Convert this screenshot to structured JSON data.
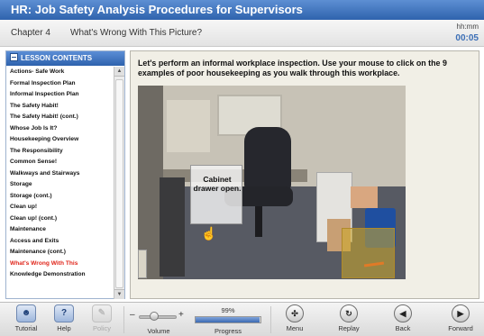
{
  "window": {
    "title": "HR: Job Safety Analysis Procedures for Supervisors"
  },
  "chapter": {
    "number": "Chapter 4",
    "title": "What's Wrong With This Picture?"
  },
  "timer": {
    "label": "hh:mm",
    "value": "00:05"
  },
  "sidebar": {
    "header": "LESSON CONTENTS",
    "items": [
      {
        "label": "Actions- Safe Work",
        "active": false
      },
      {
        "label": "Formal Inspection Plan",
        "active": false
      },
      {
        "label": "Informal Inspection Plan",
        "active": false
      },
      {
        "label": "The Safety Habit!",
        "active": false
      },
      {
        "label": "The Safety Habit! (cont.)",
        "active": false
      },
      {
        "label": "Whose Job Is It?",
        "active": false
      },
      {
        "label": "Housekeeping Overview",
        "active": false
      },
      {
        "label": "The Responsibility",
        "active": false
      },
      {
        "label": "Common Sense!",
        "active": false
      },
      {
        "label": "Walkways and Stairways",
        "active": false
      },
      {
        "label": "Storage",
        "active": false
      },
      {
        "label": "Storage (cont.)",
        "active": false
      },
      {
        "label": "Clean up!",
        "active": false
      },
      {
        "label": "Clean up! (cont.)",
        "active": false
      },
      {
        "label": "Maintenance",
        "active": false
      },
      {
        "label": "Access and Exits",
        "active": false
      },
      {
        "label": "Maintenance (cont.)",
        "active": false
      },
      {
        "label": "What's Wrong With This",
        "active": true
      },
      {
        "label": "Knowledge Demonstration",
        "active": false
      }
    ]
  },
  "content": {
    "instruction": "Let's perform an informal workplace inspection. Use your mouse to click on the 9 examples of poor housekeeping as you walk through this workplace.",
    "hotspot_label": "Cabinet drawer open."
  },
  "toolbar": {
    "tutorial": "Tutorial",
    "help": "Help",
    "policy": "Policy",
    "volume": "Volume",
    "progress_pct": "99%",
    "progress_value": 0.99,
    "progress": "Progress",
    "menu": "Menu",
    "replay": "Replay",
    "back": "Back",
    "forward": "Forward"
  },
  "colors": {
    "accent": "#3c6fb6",
    "active_item": "#e0261b"
  },
  "icons": {
    "tutorial": "tutorial-icon",
    "help": "help-icon",
    "policy": "policy-icon",
    "menu": "menu-icon",
    "replay": "replay-icon",
    "back": "back-arrow-icon",
    "forward": "forward-arrow-icon"
  }
}
